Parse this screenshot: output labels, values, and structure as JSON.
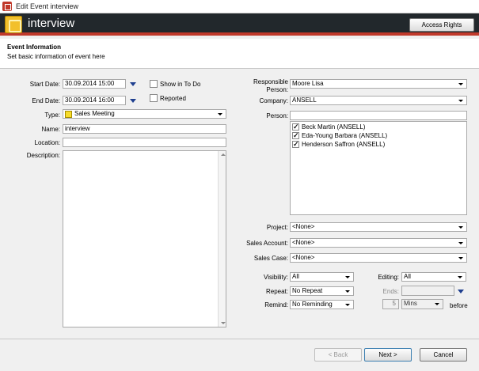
{
  "window": {
    "title": "Edit Event interview"
  },
  "header": {
    "event_name": "interview",
    "access_rights_label": "Access Rights"
  },
  "info": {
    "heading": "Event Information",
    "subheading": "Set basic information of event here"
  },
  "left": {
    "start_date_label": "Start Date:",
    "start_date_value": "30.09.2014 15:00",
    "end_date_label": "End Date:",
    "end_date_value": "30.09.2014 16:00",
    "show_in_todo_label": "Show in To Do",
    "show_in_todo_checked": false,
    "reported_label": "Reported",
    "reported_checked": false,
    "type_label": "Type:",
    "type_value": "Sales Meeting",
    "type_color": "#f7dc2a",
    "name_label": "Name:",
    "name_value": "interview",
    "location_label": "Location:",
    "location_value": "",
    "description_label": "Description:",
    "description_value": ""
  },
  "right": {
    "responsible_label_1": "Responsible",
    "responsible_label_2": "Person:",
    "responsible_value": "Moore Lisa",
    "company_label": "Company:",
    "company_value": "ANSELL",
    "person_label": "Person:",
    "person_search": "",
    "persons": [
      {
        "name": "Beck Martin (ANSELL)",
        "checked": true
      },
      {
        "name": "Eda-Young Barbara (ANSELL)",
        "checked": true
      },
      {
        "name": "Henderson Saffron (ANSELL)",
        "checked": true
      }
    ],
    "project_label": "Project:",
    "project_value": "<None>",
    "sales_account_label": "Sales Account:",
    "sales_account_value": "<None>",
    "sales_case_label": "Sales Case:",
    "sales_case_value": "<None>",
    "visibility_label": "Visibility:",
    "visibility_value": "All",
    "editing_label": "Editing:",
    "editing_value": "All",
    "repeat_label": "Repeat:",
    "repeat_value": "No Repeat",
    "ends_label": "Ends:",
    "ends_value": "",
    "remind_label": "Remind:",
    "remind_value": "No Reminding",
    "remind_amount": "5",
    "remind_unit": "Mins",
    "remind_suffix": "before"
  },
  "footer": {
    "back_label": "< Back",
    "next_label": "Next >",
    "cancel_label": "Cancel"
  }
}
